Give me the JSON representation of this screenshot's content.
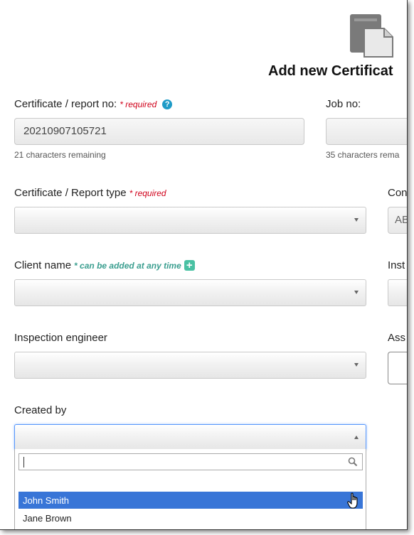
{
  "page": {
    "title": "Add new Certificat"
  },
  "fields": {
    "cert_no": {
      "label": "Certificate / report no:",
      "required": "* required",
      "value": "20210907105721",
      "hint": "21 characters remaining"
    },
    "job_no": {
      "label": "Job no:",
      "value": "",
      "hint": "35 characters rema"
    },
    "cert_type": {
      "label": "Certificate / Report type",
      "required": "* required",
      "value": ""
    },
    "company": {
      "label": "Con",
      "value": "AB"
    },
    "client_name": {
      "label": "Client name",
      "note": "* can be added at any time",
      "value": ""
    },
    "installation": {
      "label": "Inst",
      "value": ""
    },
    "inspection_engineer": {
      "label": "Inspection engineer",
      "value": ""
    },
    "assigned": {
      "label": "Ass",
      "value": ""
    },
    "created_by": {
      "label": "Created by",
      "value": "",
      "search_value": "",
      "options": [
        "John Smith",
        "Jane Brown"
      ],
      "highlighted_option": "John Smith"
    }
  },
  "icons": {
    "help": "?",
    "add": "+",
    "document": "document-icon",
    "search": "search-icon",
    "cursor": "hand-pointer-icon"
  },
  "colors": {
    "required": "#d0021b",
    "note": "#3a9e8f",
    "help": "#1e9bc7",
    "add": "#49c1a3",
    "highlight": "#3875d7"
  }
}
